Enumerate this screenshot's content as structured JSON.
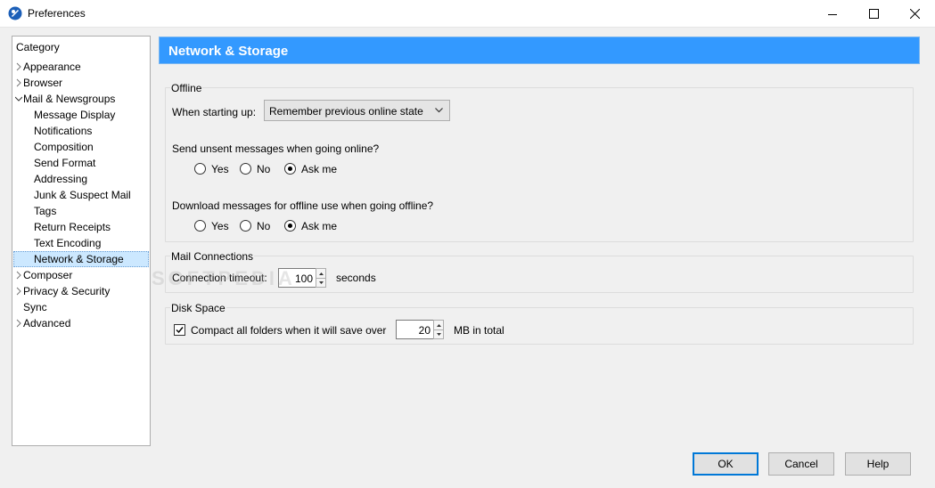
{
  "window": {
    "title": "Preferences",
    "icon": "app-logo-icon"
  },
  "category": {
    "header": "Category",
    "items": [
      {
        "label": "Appearance",
        "expandable": true,
        "expanded": false
      },
      {
        "label": "Browser",
        "expandable": true,
        "expanded": false
      },
      {
        "label": "Mail & Newsgroups",
        "expandable": true,
        "expanded": true
      },
      {
        "label": "Message Display",
        "child": true
      },
      {
        "label": "Notifications",
        "child": true
      },
      {
        "label": "Composition",
        "child": true
      },
      {
        "label": "Send Format",
        "child": true
      },
      {
        "label": "Addressing",
        "child": true
      },
      {
        "label": "Junk & Suspect Mail",
        "child": true
      },
      {
        "label": "Tags",
        "child": true
      },
      {
        "label": "Return Receipts",
        "child": true
      },
      {
        "label": "Text Encoding",
        "child": true
      },
      {
        "label": "Network & Storage",
        "child": true,
        "selected": true
      },
      {
        "label": "Composer",
        "expandable": true,
        "expanded": false
      },
      {
        "label": "Privacy & Security",
        "expandable": true,
        "expanded": false
      },
      {
        "label": "Sync"
      },
      {
        "label": "Advanced",
        "expandable": true,
        "expanded": false
      }
    ]
  },
  "page": {
    "title": "Network & Storage",
    "header_color": "#3399ff"
  },
  "offline": {
    "legend": "Offline",
    "starting_label": "When starting up:",
    "starting_value": "Remember previous online state",
    "send_question": "Send unsent messages when going online?",
    "send_options": [
      "Yes",
      "No",
      "Ask me"
    ],
    "send_selected": "Ask me",
    "download_question": "Download messages for offline use when going offline?",
    "download_options": [
      "Yes",
      "No",
      "Ask me"
    ],
    "download_selected": "Ask me"
  },
  "mail_connections": {
    "legend": "Mail Connections",
    "timeout_label": "Connection timeout:",
    "timeout_value": "100",
    "timeout_unit": "seconds"
  },
  "disk_space": {
    "legend": "Disk Space",
    "compact_label": "Compact all folders when it will save over",
    "compact_checked": true,
    "compact_value": "20",
    "compact_unit": "MB in total"
  },
  "buttons": {
    "ok": "OK",
    "cancel": "Cancel",
    "help": "Help"
  },
  "watermark": "SOFTPEDIA"
}
